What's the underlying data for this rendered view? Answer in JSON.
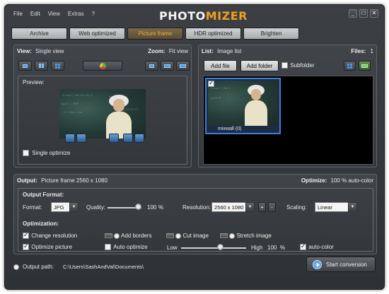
{
  "menu": [
    "File",
    "Edit",
    "View",
    "Extras",
    "?"
  ],
  "logo": {
    "part1": "PHOTO",
    "part2": "MIZER"
  },
  "window_controls": {
    "minimize": "_",
    "maximize": "□",
    "close": "✕"
  },
  "tabs": [
    "Archive",
    "Web optimized",
    "Picture frame",
    "HDR optimized",
    "Brighten"
  ],
  "view_panel": {
    "view_label": "View:",
    "view_value": "Single view",
    "zoom_label": "Zoom:",
    "zoom_value": "Fit view",
    "preview_label": "Preview:",
    "single_optimize_label": "Single optimize"
  },
  "list_panel": {
    "list_label": "List:",
    "list_value": "Image list",
    "files_label": "Files:",
    "files_count": "1",
    "add_file": "Add file",
    "add_folder": "Add folder",
    "subfolder": "Subfolder",
    "thumb_caption": "mixwall (0)"
  },
  "output": {
    "label": "Output:",
    "value": "Picture frame  2560 x 1080",
    "optimize_label": "Optimize:",
    "optimize_value": "100 % auto-color"
  },
  "format_section": {
    "title": "Output Format:",
    "format_label": "Format:",
    "format_value": "JPG",
    "quality_label": "Quality:",
    "quality_value": "100",
    "quality_unit": "%",
    "quality_fraction": 1.0,
    "resolution_label": "Resolution:",
    "resolution_value": "2560 x 1080",
    "plus": "+",
    "minus": "-",
    "scaling_label": "Scaling:",
    "scaling_value": "Linear"
  },
  "optimization": {
    "title": "Optimization:",
    "change_resolution": "Change resolution",
    "add_borders": "Add borders",
    "cut_image": "Cut image",
    "stretch_image": "Stretch image",
    "optimize_picture": "Optimize picture",
    "auto_optimize": "Auto optimize",
    "low": "Low",
    "high": "High",
    "level_value": "100",
    "level_unit": "%",
    "level_fraction": 1.0,
    "auto_color": "auto-color"
  },
  "output_path": {
    "label": "Output path:",
    "value": "C:\\Users\\SashAndVal\\Documents\\"
  },
  "start_button": "Start conversion",
  "colors": {
    "accent": "#f0a020",
    "list_bg": "#000000",
    "selection": "#3a7fd8"
  }
}
